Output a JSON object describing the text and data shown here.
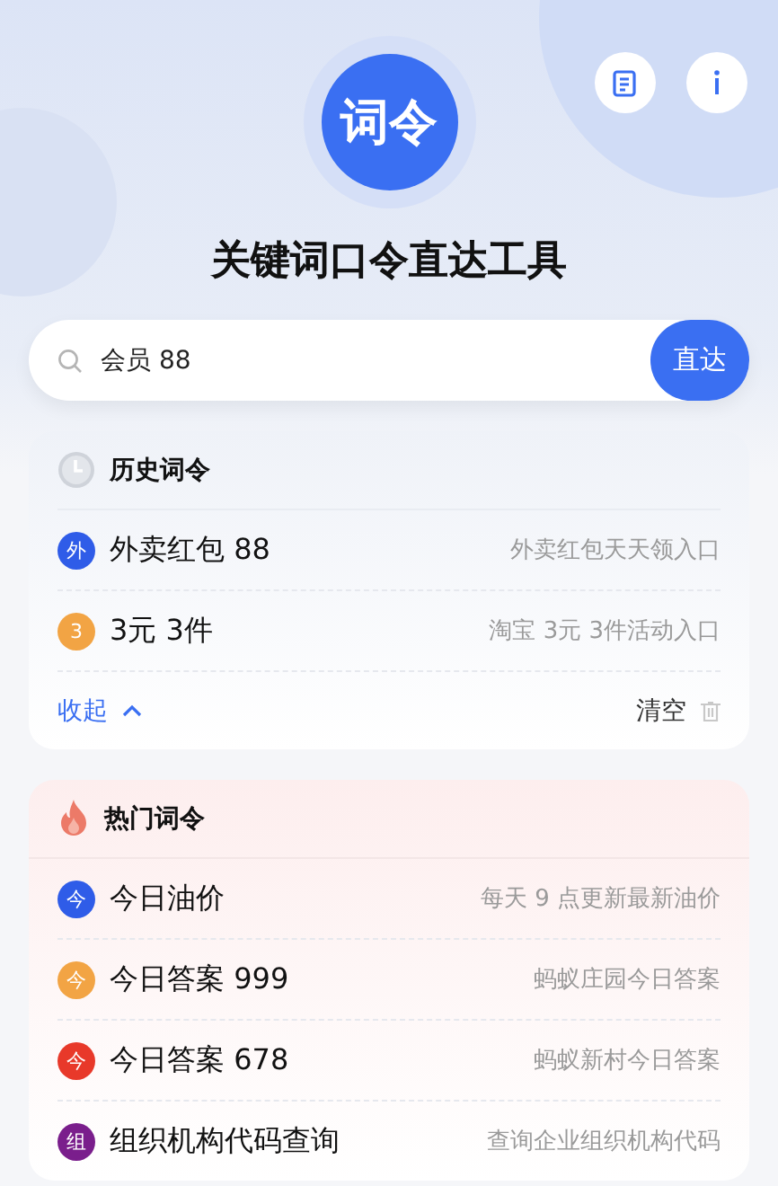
{
  "logo": {
    "text": "词令"
  },
  "title": "关键词口令直达工具",
  "search": {
    "value": "会员 88",
    "button": "直达"
  },
  "history": {
    "title": "历史词令",
    "items": [
      {
        "badge": "外",
        "name": "外卖红包 88",
        "desc": "外卖红包天天领入口",
        "color": "#2f5ce8"
      },
      {
        "badge": "3",
        "name": "3元 3件",
        "desc": "淘宝 3元 3件活动入口",
        "color": "#f2a444"
      }
    ],
    "collapse": "收起",
    "clear": "清空"
  },
  "hot": {
    "title": "热门词令",
    "items": [
      {
        "badge": "今",
        "name": "今日油价",
        "desc": "每天 9 点更新最新油价",
        "color": "#2f5ce8"
      },
      {
        "badge": "今",
        "name": "今日答案 999",
        "desc": "蚂蚁庄园今日答案",
        "color": "#f2a444"
      },
      {
        "badge": "今",
        "name": "今日答案 678",
        "desc": "蚂蚁新村今日答案",
        "color": "#e8392a"
      },
      {
        "badge": "组",
        "name": "组织机构代码查询",
        "desc": "查询企业组织机构代码",
        "color": "#7a1e8c"
      }
    ]
  }
}
